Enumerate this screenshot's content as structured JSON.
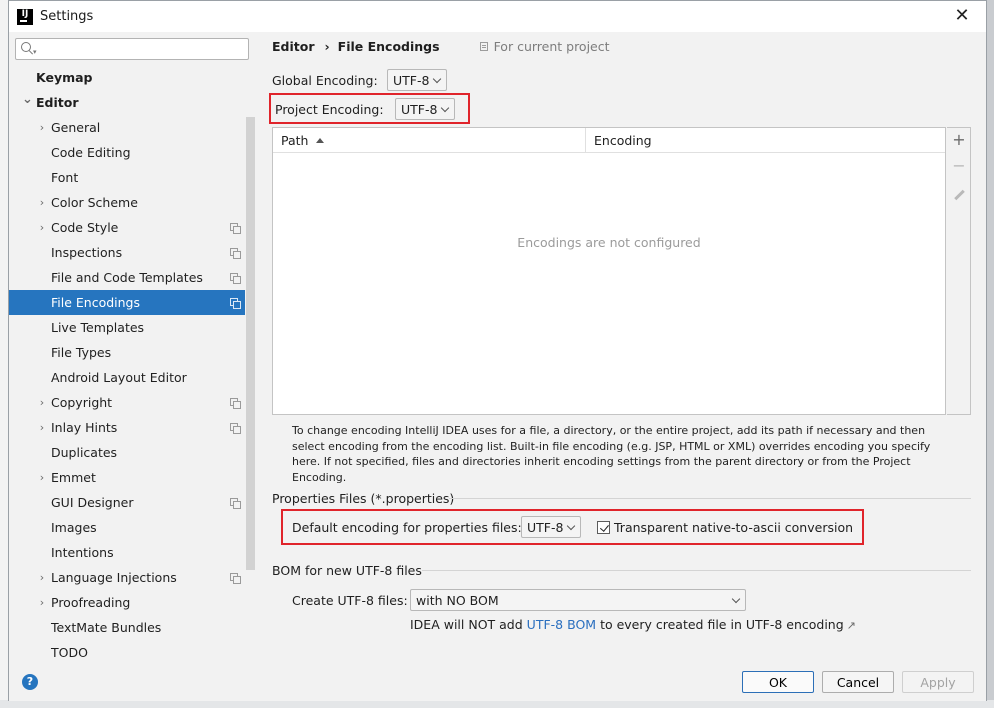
{
  "window": {
    "title": "Settings",
    "app_icon": "IJ"
  },
  "search": {
    "placeholder": "",
    "value": ""
  },
  "sidebar": {
    "items": [
      {
        "label": "Keymap",
        "level": 0,
        "bold": true,
        "expand": "none",
        "copy": false,
        "selected": false
      },
      {
        "label": "Editor",
        "level": 0,
        "bold": true,
        "expand": "open",
        "copy": false,
        "selected": false
      },
      {
        "label": "General",
        "level": 1,
        "bold": false,
        "expand": "closed",
        "copy": false,
        "selected": false
      },
      {
        "label": "Code Editing",
        "level": 1,
        "bold": false,
        "expand": "none",
        "copy": false,
        "selected": false
      },
      {
        "label": "Font",
        "level": 1,
        "bold": false,
        "expand": "none",
        "copy": false,
        "selected": false
      },
      {
        "label": "Color Scheme",
        "level": 1,
        "bold": false,
        "expand": "closed",
        "copy": false,
        "selected": false
      },
      {
        "label": "Code Style",
        "level": 1,
        "bold": false,
        "expand": "closed",
        "copy": true,
        "selected": false
      },
      {
        "label": "Inspections",
        "level": 1,
        "bold": false,
        "expand": "none",
        "copy": true,
        "selected": false
      },
      {
        "label": "File and Code Templates",
        "level": 1,
        "bold": false,
        "expand": "none",
        "copy": true,
        "selected": false
      },
      {
        "label": "File Encodings",
        "level": 1,
        "bold": false,
        "expand": "none",
        "copy": true,
        "selected": true
      },
      {
        "label": "Live Templates",
        "level": 1,
        "bold": false,
        "expand": "none",
        "copy": false,
        "selected": false
      },
      {
        "label": "File Types",
        "level": 1,
        "bold": false,
        "expand": "none",
        "copy": false,
        "selected": false
      },
      {
        "label": "Android Layout Editor",
        "level": 1,
        "bold": false,
        "expand": "none",
        "copy": false,
        "selected": false
      },
      {
        "label": "Copyright",
        "level": 1,
        "bold": false,
        "expand": "closed",
        "copy": true,
        "selected": false
      },
      {
        "label": "Inlay Hints",
        "level": 1,
        "bold": false,
        "expand": "closed",
        "copy": true,
        "selected": false
      },
      {
        "label": "Duplicates",
        "level": 1,
        "bold": false,
        "expand": "none",
        "copy": false,
        "selected": false
      },
      {
        "label": "Emmet",
        "level": 1,
        "bold": false,
        "expand": "closed",
        "copy": false,
        "selected": false
      },
      {
        "label": "GUI Designer",
        "level": 1,
        "bold": false,
        "expand": "none",
        "copy": true,
        "selected": false
      },
      {
        "label": "Images",
        "level": 1,
        "bold": false,
        "expand": "none",
        "copy": false,
        "selected": false
      },
      {
        "label": "Intentions",
        "level": 1,
        "bold": false,
        "expand": "none",
        "copy": false,
        "selected": false
      },
      {
        "label": "Language Injections",
        "level": 1,
        "bold": false,
        "expand": "closed",
        "copy": true,
        "selected": false
      },
      {
        "label": "Proofreading",
        "level": 1,
        "bold": false,
        "expand": "closed",
        "copy": false,
        "selected": false
      },
      {
        "label": "TextMate Bundles",
        "level": 1,
        "bold": false,
        "expand": "none",
        "copy": false,
        "selected": false
      },
      {
        "label": "TODO",
        "level": 1,
        "bold": false,
        "expand": "none",
        "copy": false,
        "selected": false
      }
    ]
  },
  "breadcrumb": {
    "parent": "Editor",
    "separator": "›",
    "current": "File Encodings",
    "scope": "For current project"
  },
  "global_encoding": {
    "label": "Global Encoding:",
    "value": "UTF-8"
  },
  "project_encoding": {
    "label": "Project Encoding:",
    "value": "UTF-8"
  },
  "table": {
    "columns": [
      "Path",
      "Encoding"
    ],
    "empty_text": "Encodings are not configured",
    "tools": {
      "add": "+",
      "remove": "−"
    }
  },
  "description": "To change encoding IntelliJ IDEA uses for a file, a directory, or the entire project, add its path if necessary and then select encoding from the encoding list. Built-in file encoding (e.g. JSP, HTML or XML) overrides encoding you specify here. If not specified, files and directories inherit encoding settings from the parent directory or from the Project Encoding.",
  "properties": {
    "section_title": "Properties Files (*.properties)",
    "default_label": "Default encoding for properties files:",
    "default_value": "UTF-8",
    "native_ascii_label": "Transparent native-to-ascii conversion",
    "native_ascii_checked": true
  },
  "bom": {
    "section_title": "BOM for new UTF-8 files",
    "create_label": "Create UTF-8 files:",
    "create_value": "with NO BOM",
    "note_prefix": "IDEA will NOT add",
    "note_link": "UTF-8 BOM",
    "note_suffix": "to every created file in UTF-8 encoding",
    "note_arrow": "↗"
  },
  "footer": {
    "help": "?",
    "ok": "OK",
    "cancel": "Cancel",
    "apply": "Apply"
  },
  "colors": {
    "selection": "#2675bf",
    "highlight_box": "#e0242b",
    "link": "#2a6fbf"
  }
}
